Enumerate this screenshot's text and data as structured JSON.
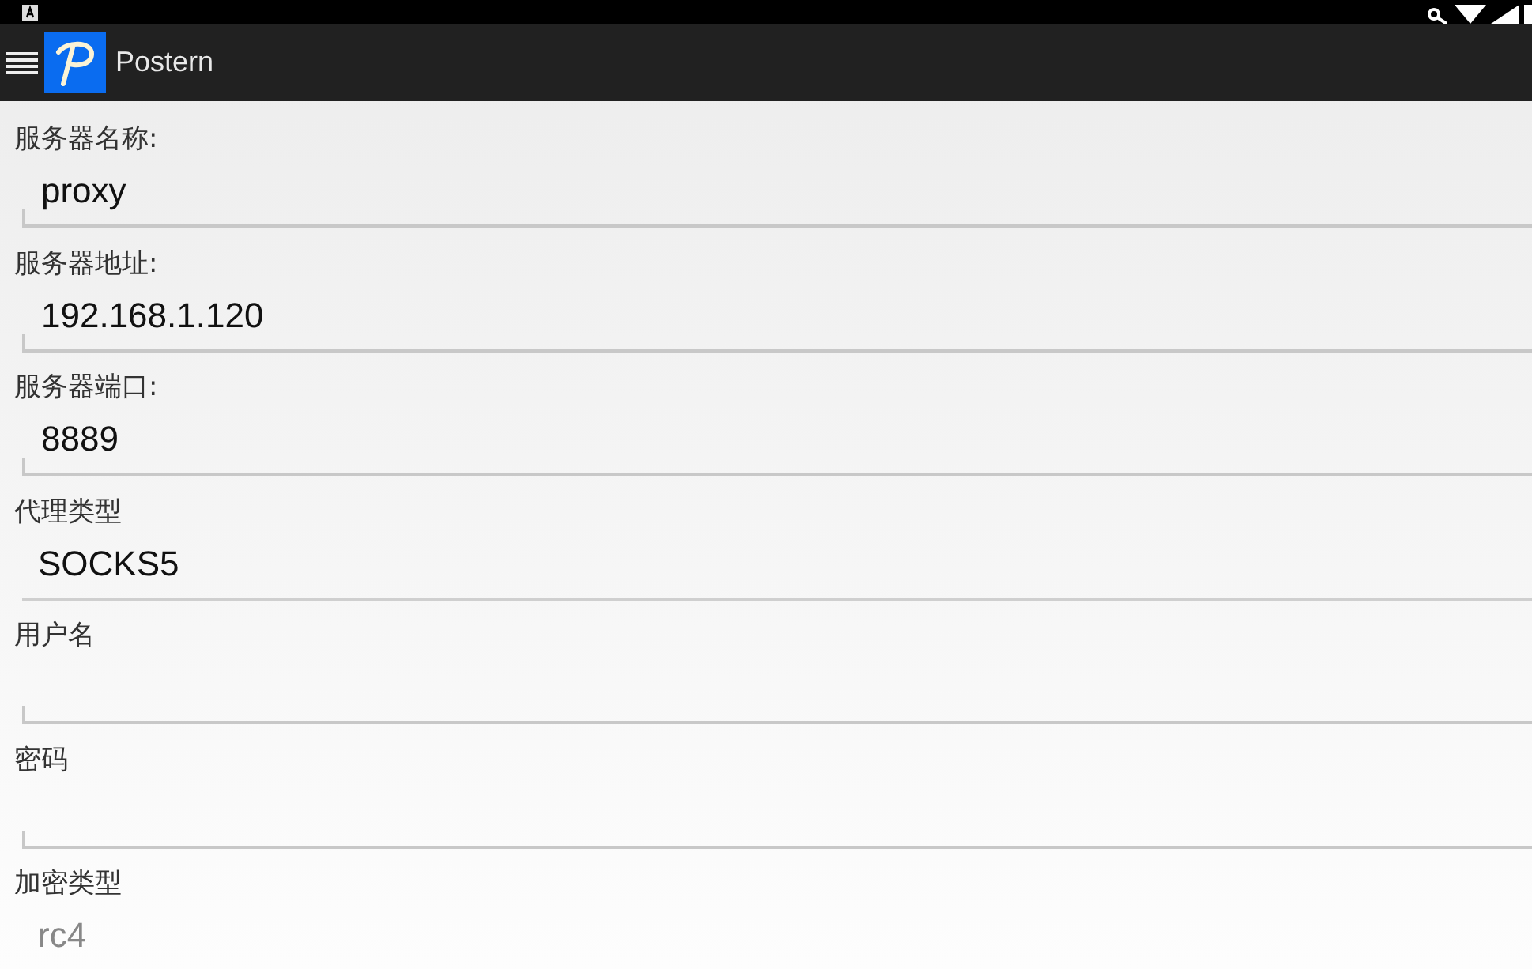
{
  "app_bar": {
    "title": "Postern"
  },
  "fields": [
    {
      "label": "服务器名称:",
      "kind": "text",
      "value": "proxy",
      "disabled": false
    },
    {
      "label": "服务器地址:",
      "kind": "text",
      "value": "192.168.1.120",
      "disabled": false
    },
    {
      "label": "服务器端口:",
      "kind": "text",
      "value": "8889",
      "disabled": false
    },
    {
      "label": "代理类型",
      "kind": "select",
      "value": "SOCKS5",
      "disabled": false
    },
    {
      "label": "用户名",
      "kind": "text",
      "disabled": false
    },
    {
      "label": "密码",
      "kind": "text",
      "disabled": false
    },
    {
      "label": "加密类型",
      "kind": "select",
      "value": "rc4",
      "disabled": true
    }
  ]
}
